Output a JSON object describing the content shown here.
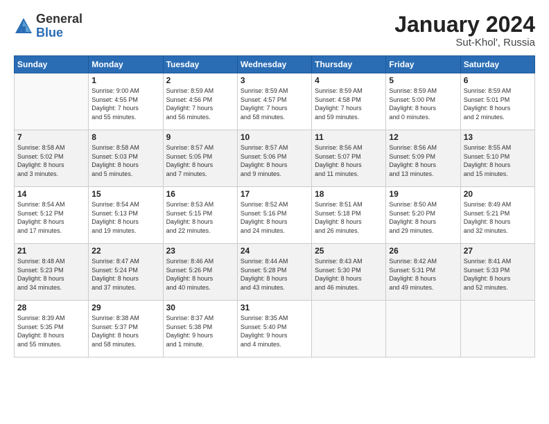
{
  "header": {
    "logo_general": "General",
    "logo_blue": "Blue",
    "title": "January 2024",
    "location": "Sut-Khol', Russia"
  },
  "days_of_week": [
    "Sunday",
    "Monday",
    "Tuesday",
    "Wednesday",
    "Thursday",
    "Friday",
    "Saturday"
  ],
  "weeks": [
    [
      {
        "num": "",
        "info": ""
      },
      {
        "num": "1",
        "info": "Sunrise: 9:00 AM\nSunset: 4:55 PM\nDaylight: 7 hours\nand 55 minutes."
      },
      {
        "num": "2",
        "info": "Sunrise: 8:59 AM\nSunset: 4:56 PM\nDaylight: 7 hours\nand 56 minutes."
      },
      {
        "num": "3",
        "info": "Sunrise: 8:59 AM\nSunset: 4:57 PM\nDaylight: 7 hours\nand 58 minutes."
      },
      {
        "num": "4",
        "info": "Sunrise: 8:59 AM\nSunset: 4:58 PM\nDaylight: 7 hours\nand 59 minutes."
      },
      {
        "num": "5",
        "info": "Sunrise: 8:59 AM\nSunset: 5:00 PM\nDaylight: 8 hours\nand 0 minutes."
      },
      {
        "num": "6",
        "info": "Sunrise: 8:59 AM\nSunset: 5:01 PM\nDaylight: 8 hours\nand 2 minutes."
      }
    ],
    [
      {
        "num": "7",
        "info": "Sunrise: 8:58 AM\nSunset: 5:02 PM\nDaylight: 8 hours\nand 3 minutes."
      },
      {
        "num": "8",
        "info": "Sunrise: 8:58 AM\nSunset: 5:03 PM\nDaylight: 8 hours\nand 5 minutes."
      },
      {
        "num": "9",
        "info": "Sunrise: 8:57 AM\nSunset: 5:05 PM\nDaylight: 8 hours\nand 7 minutes."
      },
      {
        "num": "10",
        "info": "Sunrise: 8:57 AM\nSunset: 5:06 PM\nDaylight: 8 hours\nand 9 minutes."
      },
      {
        "num": "11",
        "info": "Sunrise: 8:56 AM\nSunset: 5:07 PM\nDaylight: 8 hours\nand 11 minutes."
      },
      {
        "num": "12",
        "info": "Sunrise: 8:56 AM\nSunset: 5:09 PM\nDaylight: 8 hours\nand 13 minutes."
      },
      {
        "num": "13",
        "info": "Sunrise: 8:55 AM\nSunset: 5:10 PM\nDaylight: 8 hours\nand 15 minutes."
      }
    ],
    [
      {
        "num": "14",
        "info": "Sunrise: 8:54 AM\nSunset: 5:12 PM\nDaylight: 8 hours\nand 17 minutes."
      },
      {
        "num": "15",
        "info": "Sunrise: 8:54 AM\nSunset: 5:13 PM\nDaylight: 8 hours\nand 19 minutes."
      },
      {
        "num": "16",
        "info": "Sunrise: 8:53 AM\nSunset: 5:15 PM\nDaylight: 8 hours\nand 22 minutes."
      },
      {
        "num": "17",
        "info": "Sunrise: 8:52 AM\nSunset: 5:16 PM\nDaylight: 8 hours\nand 24 minutes."
      },
      {
        "num": "18",
        "info": "Sunrise: 8:51 AM\nSunset: 5:18 PM\nDaylight: 8 hours\nand 26 minutes."
      },
      {
        "num": "19",
        "info": "Sunrise: 8:50 AM\nSunset: 5:20 PM\nDaylight: 8 hours\nand 29 minutes."
      },
      {
        "num": "20",
        "info": "Sunrise: 8:49 AM\nSunset: 5:21 PM\nDaylight: 8 hours\nand 32 minutes."
      }
    ],
    [
      {
        "num": "21",
        "info": "Sunrise: 8:48 AM\nSunset: 5:23 PM\nDaylight: 8 hours\nand 34 minutes."
      },
      {
        "num": "22",
        "info": "Sunrise: 8:47 AM\nSunset: 5:24 PM\nDaylight: 8 hours\nand 37 minutes."
      },
      {
        "num": "23",
        "info": "Sunrise: 8:46 AM\nSunset: 5:26 PM\nDaylight: 8 hours\nand 40 minutes."
      },
      {
        "num": "24",
        "info": "Sunrise: 8:44 AM\nSunset: 5:28 PM\nDaylight: 8 hours\nand 43 minutes."
      },
      {
        "num": "25",
        "info": "Sunrise: 8:43 AM\nSunset: 5:30 PM\nDaylight: 8 hours\nand 46 minutes."
      },
      {
        "num": "26",
        "info": "Sunrise: 8:42 AM\nSunset: 5:31 PM\nDaylight: 8 hours\nand 49 minutes."
      },
      {
        "num": "27",
        "info": "Sunrise: 8:41 AM\nSunset: 5:33 PM\nDaylight: 8 hours\nand 52 minutes."
      }
    ],
    [
      {
        "num": "28",
        "info": "Sunrise: 8:39 AM\nSunset: 5:35 PM\nDaylight: 8 hours\nand 55 minutes."
      },
      {
        "num": "29",
        "info": "Sunrise: 8:38 AM\nSunset: 5:37 PM\nDaylight: 8 hours\nand 58 minutes."
      },
      {
        "num": "30",
        "info": "Sunrise: 8:37 AM\nSunset: 5:38 PM\nDaylight: 9 hours\nand 1 minute."
      },
      {
        "num": "31",
        "info": "Sunrise: 8:35 AM\nSunset: 5:40 PM\nDaylight: 9 hours\nand 4 minutes."
      },
      {
        "num": "",
        "info": ""
      },
      {
        "num": "",
        "info": ""
      },
      {
        "num": "",
        "info": ""
      }
    ]
  ]
}
